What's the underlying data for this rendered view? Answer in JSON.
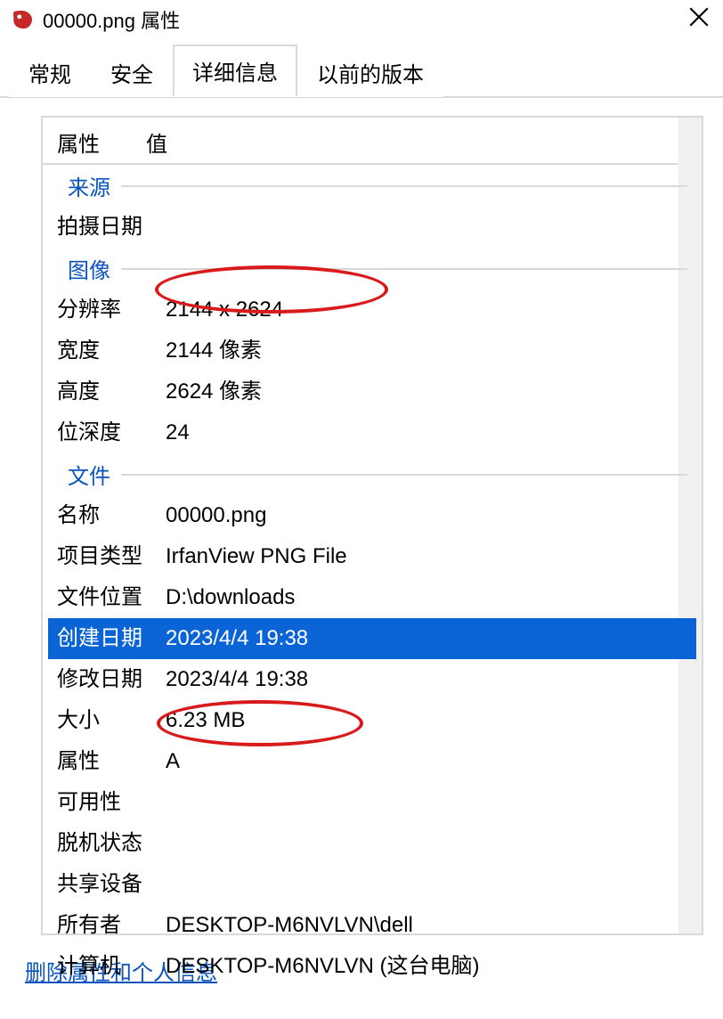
{
  "window": {
    "title": "00000.png 属性"
  },
  "tabs": {
    "items": [
      {
        "label": "常规"
      },
      {
        "label": "安全"
      },
      {
        "label": "详细信息",
        "active": true
      },
      {
        "label": "以前的版本"
      }
    ]
  },
  "columns": {
    "property": "属性",
    "value": "值"
  },
  "groups": {
    "origin": {
      "header": "来源",
      "rows": [
        {
          "prop": "拍摄日期",
          "val": ""
        }
      ]
    },
    "image": {
      "header": "图像",
      "rows": [
        {
          "prop": "分辨率",
          "val": "2144 x 2624"
        },
        {
          "prop": "宽度",
          "val": "2144 像素"
        },
        {
          "prop": "高度",
          "val": "2624 像素"
        },
        {
          "prop": "位深度",
          "val": "24"
        }
      ]
    },
    "file": {
      "header": "文件",
      "rows": [
        {
          "prop": "名称",
          "val": "00000.png"
        },
        {
          "prop": "项目类型",
          "val": "IrfanView PNG File"
        },
        {
          "prop": "文件位置",
          "val": "D:\\downloads"
        },
        {
          "prop": "创建日期",
          "val": "2023/4/4 19:38",
          "selected": true
        },
        {
          "prop": "修改日期",
          "val": "2023/4/4 19:38"
        },
        {
          "prop": "大小",
          "val": "6.23 MB"
        },
        {
          "prop": "属性",
          "val": "A"
        },
        {
          "prop": "可用性",
          "val": ""
        },
        {
          "prop": "脱机状态",
          "val": ""
        },
        {
          "prop": "共享设备",
          "val": ""
        },
        {
          "prop": "所有者",
          "val": "DESKTOP-M6NVLVN\\dell"
        },
        {
          "prop": "计算机",
          "val": "DESKTOP-M6NVLVN (这台电脑)"
        }
      ]
    }
  },
  "link": {
    "remove_props": "删除属性和个人信息"
  }
}
